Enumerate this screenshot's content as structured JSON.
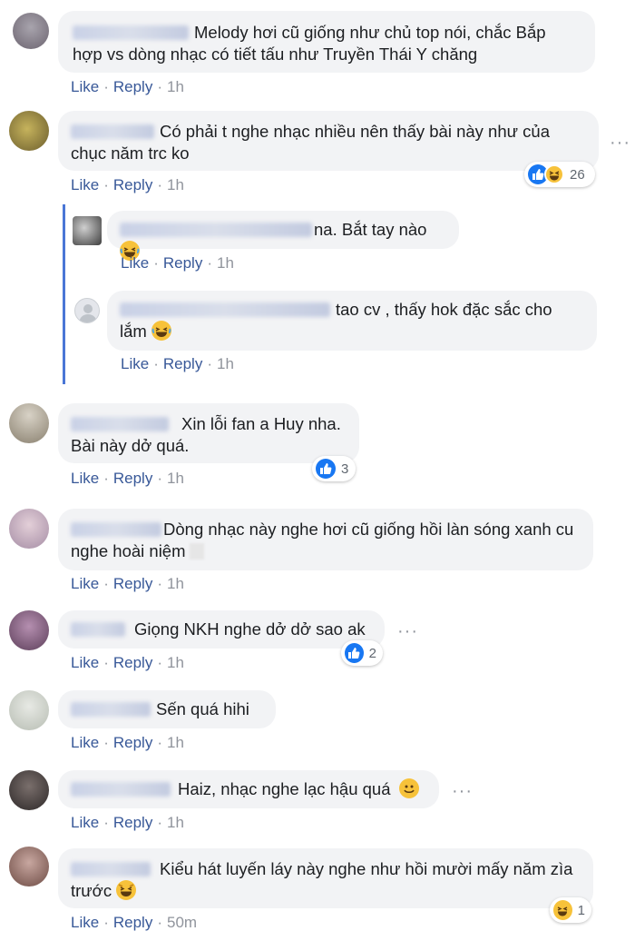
{
  "actions": {
    "like": "Like",
    "reply": "Reply",
    "dot": "·"
  },
  "comments": [
    {
      "text": "Melody hơi cũ giống như chủ top nói, chắc Bắp hợp vs dòng nhạc có tiết tấu như Truyền Thái Y chăng",
      "time": "1h"
    },
    {
      "text": "Có phải t nghe nhạc nhiều nên thấy bài này như của chục năm trc ko",
      "time": "1h",
      "reaction_count": "26"
    },
    {
      "text": "na. Bắt tay nào",
      "time": "1h"
    },
    {
      "text": "tao cv , thấy hok đặc sắc cho lắm",
      "time": "1h"
    },
    {
      "text": "Xin lỗi fan a Huy nha. Bài này dở quá.",
      "time": "1h",
      "reaction_count": "3"
    },
    {
      "text": "Dòng nhạc này nghe hơi cũ giống hồi làn sóng xanh cu nghe hoài niệm",
      "time": "1h"
    },
    {
      "text": "Giọng NKH nghe dở dở sao ak",
      "time": "1h",
      "reaction_count": "2"
    },
    {
      "text": "Sến quá hihi",
      "time": "1h"
    },
    {
      "text": "Haiz, nhạc nghe lạc hậu quá",
      "time": "1h"
    },
    {
      "text": "Kiểu hát luyến láy này nghe như hồi mười mấy năm zìa trước",
      "time": "50m",
      "reaction_count": "1"
    }
  ],
  "icons": {
    "like": "like-reaction-icon",
    "haha": "haha-reaction-icon",
    "more": "more-options-icon"
  },
  "colors": {
    "link": "#385898",
    "bubble": "#f2f3f5",
    "like": "#1877f2",
    "haha": "#f7c23a",
    "thread_line": "#4a76d6"
  }
}
